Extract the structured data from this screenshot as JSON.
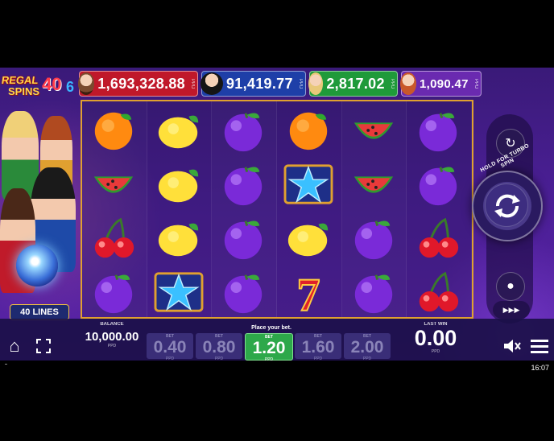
{
  "logo": {
    "line1": "REGAL",
    "line2": "SPINS",
    "number": "40",
    "number2": "6",
    "sub": "REELS"
  },
  "jackpots": [
    {
      "value": "1,693,328.88",
      "currency": "PPD",
      "color": "#c0182a"
    },
    {
      "value": "91,419.77",
      "currency": "PPD",
      "color": "#1e3fa8"
    },
    {
      "value": "2,817.02",
      "currency": "PPD",
      "color": "#1f9a3a"
    },
    {
      "value": "1,090.47",
      "currency": "PPD",
      "color": "#6a2ab0"
    }
  ],
  "lines_label": "40 LINES",
  "reels": [
    [
      "orange",
      "watermelon",
      "cherry",
      "plum"
    ],
    [
      "lemon",
      "lemon",
      "lemon",
      "star"
    ],
    [
      "plum",
      "plum",
      "plum",
      "plum"
    ],
    [
      "orange",
      "star",
      "lemon",
      "seven"
    ],
    [
      "watermelon",
      "watermelon",
      "plum",
      "plum"
    ],
    [
      "plum",
      "plum",
      "cherry",
      "cherry"
    ]
  ],
  "controls": {
    "turbo_label": "HOLD FOR TURBO SPIN",
    "autoplay_icon": "autoplay-icon",
    "spin_icon": "spin-icon",
    "stake_icon": "coin-stack-icon",
    "fast_icon": "fast-forward-icon"
  },
  "bottom": {
    "balance_label": "BALANCE",
    "balance": "10,000.00",
    "balance_currency": "PPD",
    "place_bet": "Place your bet.",
    "bets": [
      {
        "label": "BET",
        "value": "0.40",
        "currency": "PPD",
        "selected": false
      },
      {
        "label": "BET",
        "value": "0.80",
        "currency": "PPD",
        "selected": false
      },
      {
        "label": "BET",
        "value": "1.20",
        "currency": "PPD",
        "selected": true
      },
      {
        "label": "BET",
        "value": "1.60",
        "currency": "PPD",
        "selected": false
      },
      {
        "label": "BET",
        "value": "2.00",
        "currency": "PPD",
        "selected": false
      }
    ],
    "last_win_label": "LAST WIN",
    "last_win": "0.00",
    "last_win_currency": "PPD"
  },
  "status": {
    "time": "16:07"
  }
}
